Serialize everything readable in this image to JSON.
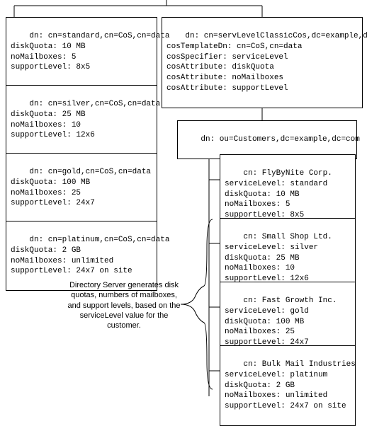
{
  "cosDefinition": {
    "lines": [
      "dn: cn=servLevelClassicCos,dc=example,dc=com",
      "cosTemplateDn: cn=CoS,cn=data",
      "cosSpecifier: serviceLevel",
      "cosAttribute: diskQuota",
      "cosAttribute: noMailboxes",
      "cosAttribute: supportLevel"
    ]
  },
  "customersOU": {
    "line": "dn: ou=Customers,dc=example,dc=com"
  },
  "templates": [
    {
      "lines": [
        "dn: cn=standard,cn=CoS,cn=data",
        "diskQuota: 10 MB",
        "noMailboxes: 5",
        "supportLevel: 8x5"
      ]
    },
    {
      "lines": [
        "dn: cn=silver,cn=CoS,cn=data",
        "diskQuota: 25 MB",
        "noMailboxes: 10",
        "supportLevel: 12x6"
      ]
    },
    {
      "lines": [
        "dn: cn=gold,cn=CoS,cn=data",
        "diskQuota: 100 MB",
        "noMailboxes: 25",
        "supportLevel: 24x7"
      ]
    },
    {
      "lines": [
        "dn: cn=platinum,cn=CoS,cn=data",
        "diskQuota: 2 GB",
        "noMailboxes: unlimited",
        "supportLevel: 24x7 on site"
      ]
    }
  ],
  "customers": [
    {
      "lines": [
        "cn: FlyByNite Corp.",
        "serviceLevel: standard",
        "diskQuota: 10 MB",
        "noMailboxes: 5",
        "supportLevel: 8x5"
      ]
    },
    {
      "lines": [
        "cn: Small Shop Ltd.",
        "serviceLevel: silver",
        "diskQuota: 25 MB",
        "noMailboxes: 10",
        "supportLevel: 12x6"
      ]
    },
    {
      "lines": [
        "cn: Fast Growth Inc.",
        "serviceLevel: gold",
        "diskQuota: 100 MB",
        "noMailboxes: 25",
        "supportLevel: 24x7"
      ]
    },
    {
      "lines": [
        "cn: Bulk Mail Industries",
        "serviceLevel: platinum",
        "diskQuota: 2 GB",
        "noMailboxes: unlimited",
        "supportLevel: 24x7 on site"
      ]
    }
  ],
  "note": {
    "text": "Directory Server generates\ndisk quotas, numbers of\nmailboxes, and support levels,\nbased on the serviceLevel\nvalue for the customer."
  }
}
